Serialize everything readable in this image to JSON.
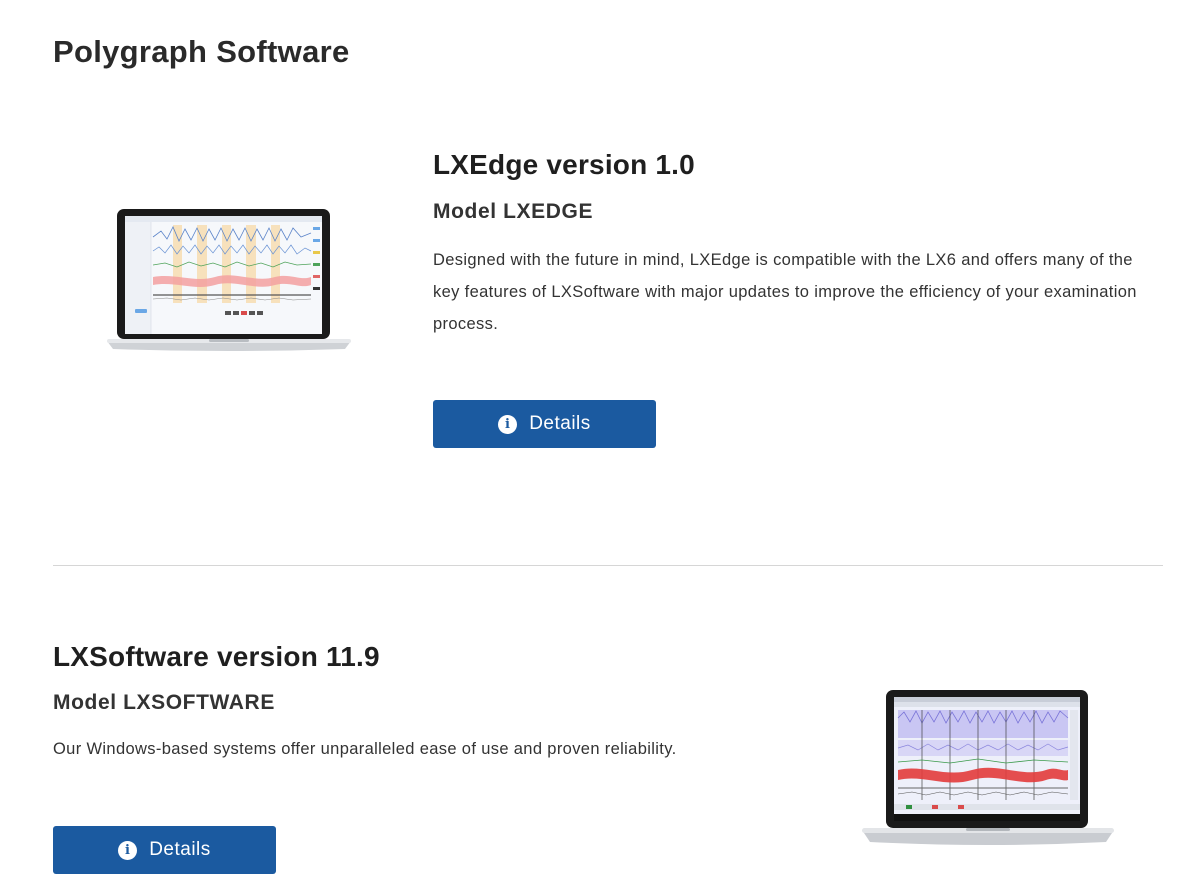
{
  "page": {
    "title": "Polygraph Software"
  },
  "products": [
    {
      "title": "LXEdge version 1.0",
      "model": "Model LXEDGE",
      "description": "Designed with the future in mind, LXEdge is compatible with the LX6 and offers many of the key features of LXSoftware with major updates to improve the efficiency of your examination process.",
      "button_label": "Details",
      "button_icon": "info-icon"
    },
    {
      "title": "LXSoftware version 11.9",
      "model": "Model LXSOFTWARE",
      "description": "Our Windows-based systems offer unparalleled ease of use and proven reliability.",
      "button_label": "Details",
      "button_icon": "info-icon"
    }
  ],
  "colors": {
    "button_bg": "#1b5aa0",
    "divider": "#d6d6d6",
    "text": "#222222"
  }
}
